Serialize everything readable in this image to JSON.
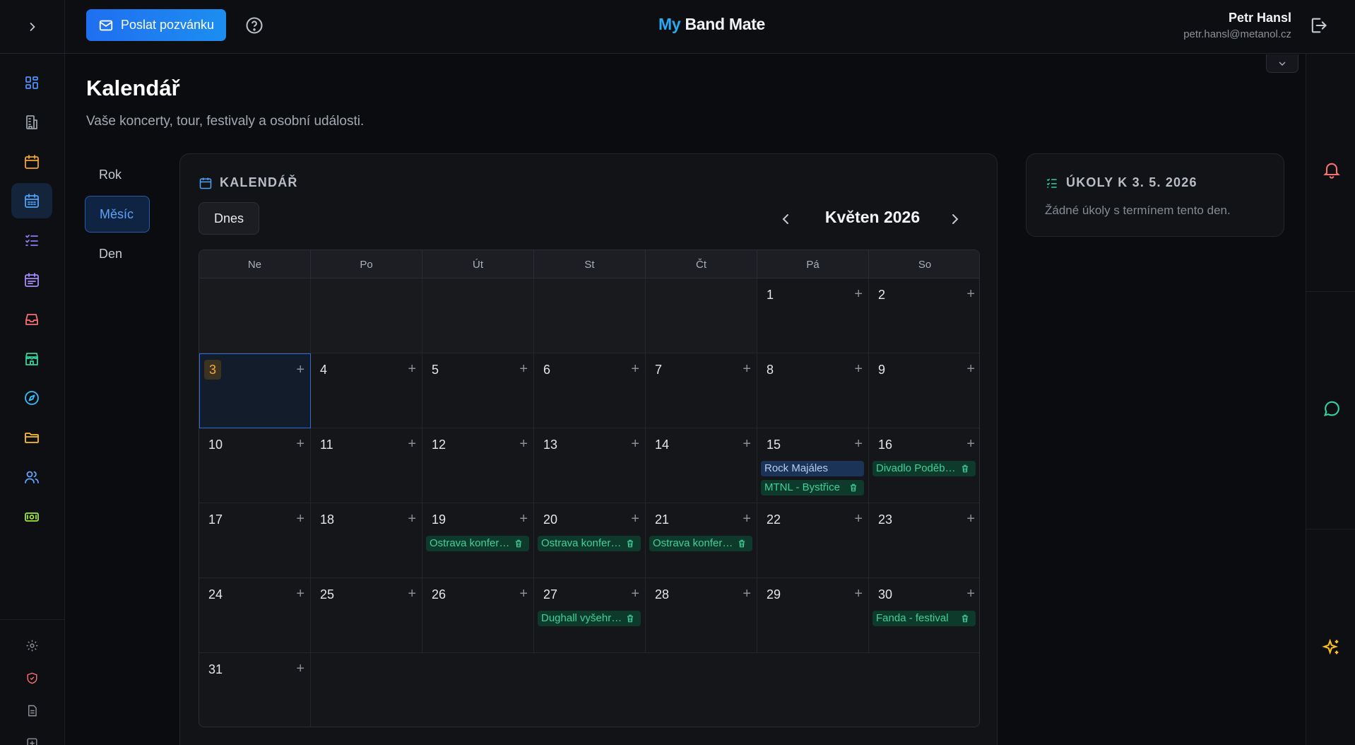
{
  "header": {
    "invite_label": "Poslat pozvánku",
    "brand_my": "My",
    "brand_rest": " Band Mate",
    "user_name": "Petr Hansl",
    "user_email": "petr.hansl@metanol.cz"
  },
  "sidebar": {
    "items": [
      {
        "icon": "dashboard-icon",
        "color": "#4f8ff7"
      },
      {
        "icon": "building-icon",
        "color": "#9aa0aa"
      },
      {
        "icon": "calendar-icon",
        "color": "#f5a524"
      },
      {
        "icon": "calendar-days-icon",
        "color": "#4fa3f7",
        "active": true
      },
      {
        "icon": "checklist-icon",
        "color": "#8b7cf6"
      },
      {
        "icon": "calendar-range-icon",
        "color": "#a78bfa"
      },
      {
        "icon": "inbox-icon",
        "color": "#f87171"
      },
      {
        "icon": "store-icon",
        "color": "#34d399"
      },
      {
        "icon": "compass-icon",
        "color": "#38bdf8"
      },
      {
        "icon": "folder-icon",
        "color": "#fbbf24"
      },
      {
        "icon": "users-icon",
        "color": "#60a5fa"
      },
      {
        "icon": "money-icon",
        "color": "#a3e635"
      }
    ]
  },
  "page": {
    "title": "Kalendář",
    "subtitle": "Vaše koncerty, tour, festivaly a osobní události."
  },
  "views": [
    "Rok",
    "Měsíc",
    "Den"
  ],
  "calendar": {
    "heading": "KALENDÁŘ",
    "today_label": "Dnes",
    "month_label": "Květen 2026",
    "weekdays": [
      "Ne",
      "Po",
      "Út",
      "St",
      "Čt",
      "Pá",
      "So"
    ],
    "weeks": [
      [
        null,
        null,
        null,
        null,
        null,
        1,
        2
      ],
      [
        3,
        4,
        5,
        6,
        7,
        8,
        9
      ],
      [
        10,
        11,
        12,
        13,
        14,
        15,
        16
      ],
      [
        17,
        18,
        19,
        20,
        21,
        22,
        23
      ],
      [
        24,
        25,
        26,
        27,
        28,
        29,
        30
      ],
      [
        31
      ]
    ],
    "today": 3,
    "events": [
      {
        "day": 15,
        "title": "Rock Majáles",
        "type": "blue"
      },
      {
        "day": 15,
        "title": "MTNL - Bystřice",
        "type": "green"
      },
      {
        "day": 16,
        "title": "Divadlo Poděbrady",
        "type": "green"
      },
      {
        "day": 19,
        "title": "Ostrava konference",
        "type": "green"
      },
      {
        "day": 20,
        "title": "Ostrava konference",
        "type": "green"
      },
      {
        "day": 21,
        "title": "Ostrava konference",
        "type": "green"
      },
      {
        "day": 27,
        "title": "Dughall vyšehrad",
        "type": "green"
      },
      {
        "day": 30,
        "title": "Fanda - festival",
        "type": "green"
      }
    ]
  },
  "tasks": {
    "heading": "ÚKOLY K 3. 5. 2026",
    "empty_text": "Žádné úkoly s termínem tento den."
  }
}
